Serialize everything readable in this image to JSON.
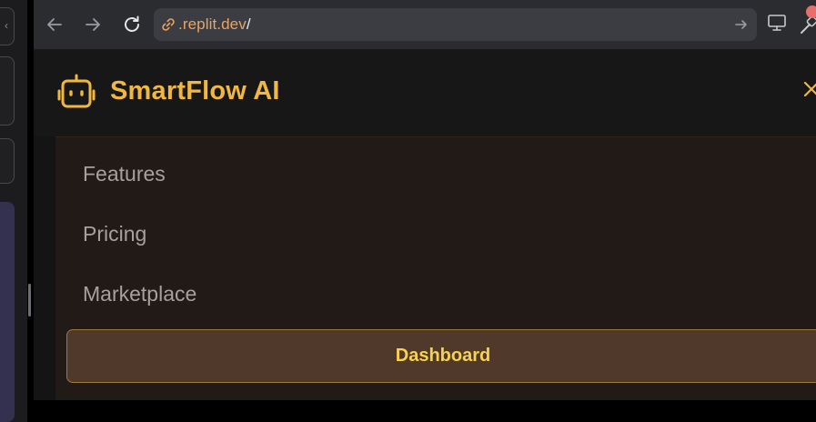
{
  "browser": {
    "url": ".replit.dev/",
    "colors": {
      "toolbar": "#2b2c30",
      "urlbar": "#3c3d42",
      "url_text": "#e8a462"
    },
    "icons": [
      "back-arrow-icon",
      "forward-arrow-icon",
      "reload-icon",
      "link-icon",
      "go-arrow-icon",
      "monitor-icon",
      "tool-icon"
    ]
  },
  "page": {
    "brand": "SmartFlow AI",
    "menu": {
      "items": [
        {
          "label": "Features"
        },
        {
          "label": "Pricing"
        },
        {
          "label": "Marketplace"
        }
      ],
      "dashboard_label": "Dashboard"
    },
    "colors": {
      "accent": "#f1b73e",
      "dashboard_text": "#f8d24f",
      "menu_bg": "#221a16",
      "button_bg": "#50392a"
    },
    "icons": [
      "robot-logo-icon",
      "close-icon"
    ]
  }
}
